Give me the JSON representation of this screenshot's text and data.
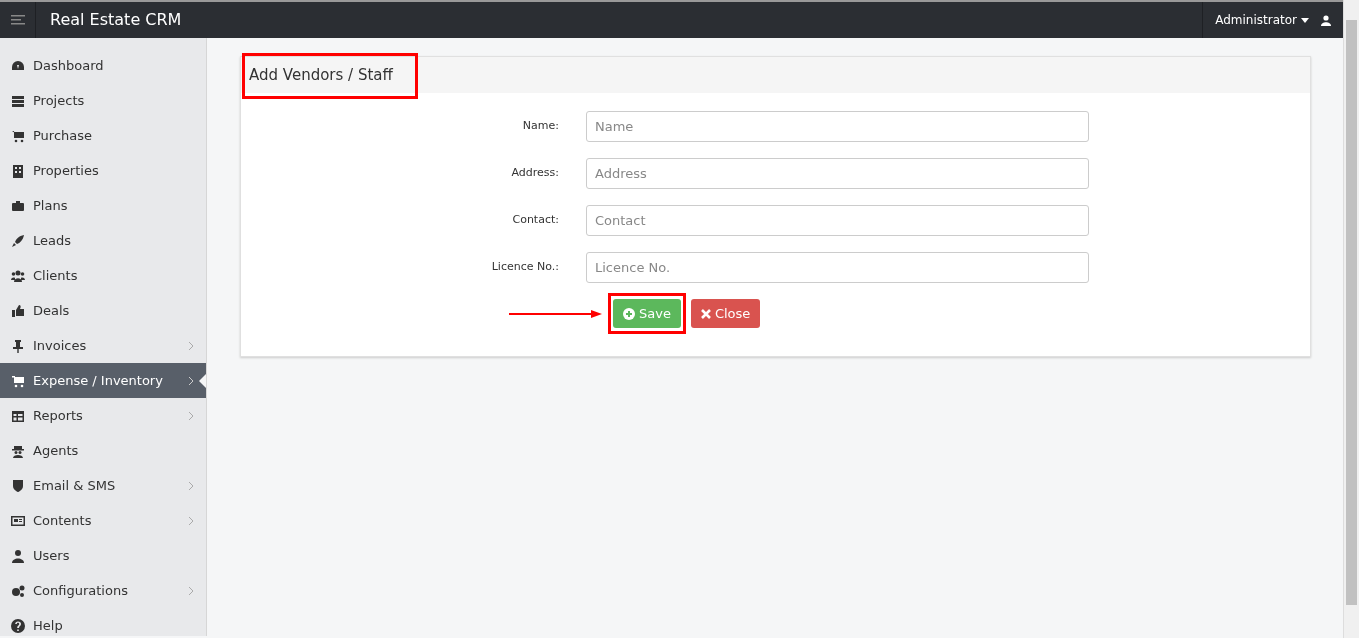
{
  "topbar": {
    "title": "Real Estate CRM",
    "user": "Administrator"
  },
  "sidebar": {
    "items": [
      {
        "label": "Dashboard",
        "selected": false,
        "has_submenu": false
      },
      {
        "label": "Projects",
        "selected": false,
        "has_submenu": false
      },
      {
        "label": "Purchase",
        "selected": false,
        "has_submenu": false
      },
      {
        "label": "Properties",
        "selected": false,
        "has_submenu": false
      },
      {
        "label": "Plans",
        "selected": false,
        "has_submenu": false
      },
      {
        "label": "Leads",
        "selected": false,
        "has_submenu": false
      },
      {
        "label": "Clients",
        "selected": false,
        "has_submenu": false
      },
      {
        "label": "Deals",
        "selected": false,
        "has_submenu": false
      },
      {
        "label": "Invoices",
        "selected": false,
        "has_submenu": true
      },
      {
        "label": "Expense / Inventory",
        "selected": true,
        "has_submenu": true
      },
      {
        "label": "Reports",
        "selected": false,
        "has_submenu": true
      },
      {
        "label": "Agents",
        "selected": false,
        "has_submenu": false
      },
      {
        "label": "Email & SMS",
        "selected": false,
        "has_submenu": true
      },
      {
        "label": "Contents",
        "selected": false,
        "has_submenu": true
      },
      {
        "label": "Users",
        "selected": false,
        "has_submenu": false
      },
      {
        "label": "Configurations",
        "selected": false,
        "has_submenu": true
      },
      {
        "label": "Help",
        "selected": false,
        "has_submenu": false
      }
    ]
  },
  "panel": {
    "title": "Add Vendors / Staff",
    "fields": [
      {
        "label": "Name:",
        "placeholder": "Name"
      },
      {
        "label": "Address:",
        "placeholder": "Address"
      },
      {
        "label": "Contact:",
        "placeholder": "Contact"
      },
      {
        "label": "Licence No.:",
        "placeholder": "Licence No."
      }
    ],
    "buttons": [
      {
        "kind": "save",
        "label": "Save"
      },
      {
        "kind": "close",
        "label": "Close"
      }
    ]
  }
}
